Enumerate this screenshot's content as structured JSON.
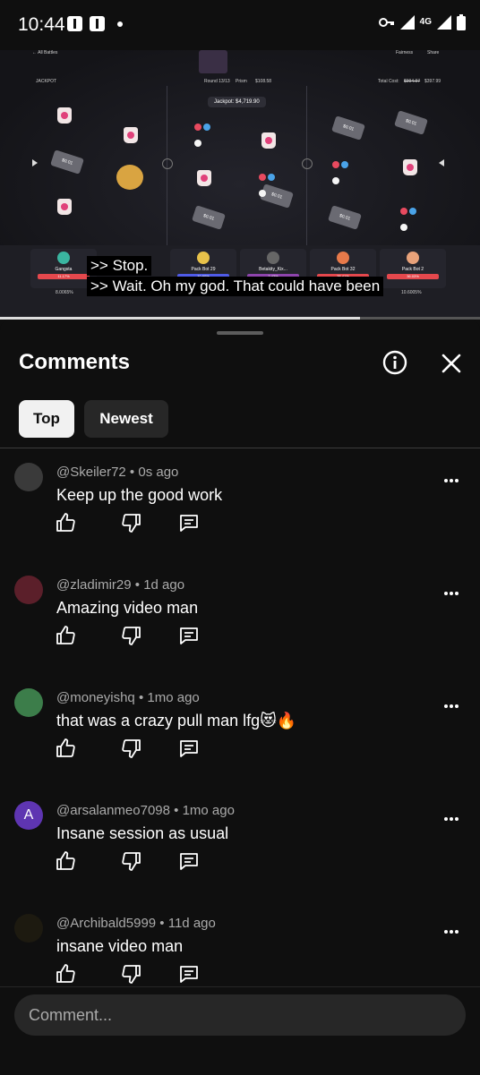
{
  "status_bar": {
    "time": "10:44",
    "network": "4G"
  },
  "video": {
    "top_left": "← All Battles",
    "jackpot_label": "JACKPOT",
    "round": "Round 13/13",
    "prism": "Prism",
    "prism_value": "$108.58",
    "fairness": "Fairness",
    "share": "Share",
    "total_cost_label": "Total Cost:",
    "total_cost_old": "$994.97",
    "total_cost_new": "$397.99",
    "jackpot_value": "Jackpot: $4,719.90",
    "ticket_value": "$0.01",
    "players": [
      {
        "name": "Gangsta",
        "pct": "11.17%",
        "color": "#e5484d"
      },
      {
        "name": "Pack Bot 29",
        "pct": "10.60%",
        "color": "#4f5be8"
      },
      {
        "name": "Betakity_Kix...",
        "pct": "2.43%",
        "color": "#8e44ad"
      },
      {
        "name": "Pack Bot 32",
        "pct": "38.41%",
        "color": "#e5484d"
      },
      {
        "name": "Pack Bot 2",
        "pct": "36.03%",
        "color": "#e5484d"
      }
    ],
    "row_values": [
      "8.0065%",
      "10.6005%"
    ],
    "captions": [
      ">> Stop.",
      ">> Wait. Oh my god. That could have been"
    ],
    "progress": 0.75
  },
  "sheet": {
    "title": "Comments",
    "chips": [
      {
        "label": "Top"
      },
      {
        "label": "Newest"
      }
    ]
  },
  "comments": [
    {
      "author": "@Skeiler72",
      "time": "0s ago",
      "text": "Keep up the good work",
      "avatar_color": "#3a3a3a",
      "avatar_letter": ""
    },
    {
      "author": "@zladimir29",
      "time": "1d ago",
      "text": "Amazing video man",
      "avatar_color": "#5b1f2a",
      "avatar_letter": ""
    },
    {
      "author": "@moneyishq",
      "time": "1mo ago",
      "text": "that was a crazy pull man lfg😻🔥",
      "avatar_color": "#3c7d4a",
      "avatar_letter": ""
    },
    {
      "author": "@arsalanmeo7098",
      "time": "1mo ago",
      "text": "Insane session as usual",
      "avatar_color": "#5e35b1",
      "avatar_letter": "A"
    },
    {
      "author": "@Archibald5999",
      "time": "11d ago",
      "text": "insane video man",
      "avatar_color": "#1d1a10",
      "avatar_letter": ""
    }
  ],
  "input": {
    "placeholder": "Comment..."
  },
  "colors": {
    "background": "#0f0f0f",
    "chip_active": "#f1f1f1",
    "chip_inactive": "#272727",
    "meta_text": "#aaaaaa"
  }
}
